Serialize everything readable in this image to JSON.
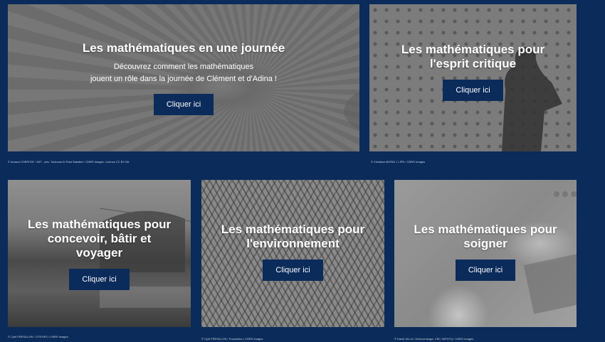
{
  "colors": {
    "background": "#0b2b5a",
    "button_bg": "#0b2b5a",
    "text": "#ffffff"
  },
  "cards": [
    {
      "title": "Les mathématiques en une journée",
      "description_line1": "Découvrez comment les mathématiques",
      "description_line2": "jouent un rôle dans la journée de Clément et d'Adina !",
      "button_label": "Cliquer ici",
      "credit": "© Arnaud CHERITAT / IMT - univ. Toulouse III-Paul Sabatier / CNRS Images. Licence CC BY-SA"
    },
    {
      "title_line1": "Les mathématiques pour",
      "title_line2": "l'esprit critique",
      "button_label": "Cliquer ici",
      "credit": "© Christian MOREL / LIPN / CNRS Images"
    },
    {
      "title_line1": "Les mathématiques pour",
      "title_line2": "concevoir, bâtir et",
      "title_line3": "voyager",
      "button_label": "Cliquer ici",
      "credit": "© Cyril FRESILLON / CITEVES / CNRS Images"
    },
    {
      "title_line1": "Les mathématiques pour",
      "title_line2": "l'environnement",
      "button_label": "Cliquer ici",
      "credit": "© Cyril FRESILLON / Fracamina / CNRS Images"
    },
    {
      "title_line1": "Les mathématiques pour",
      "title_line2": "soigner",
      "button_label": "Cliquer ici",
      "credit": "© David VILLA / ScienceImage, CBI / INPHYQ / CNRS Images"
    }
  ]
}
